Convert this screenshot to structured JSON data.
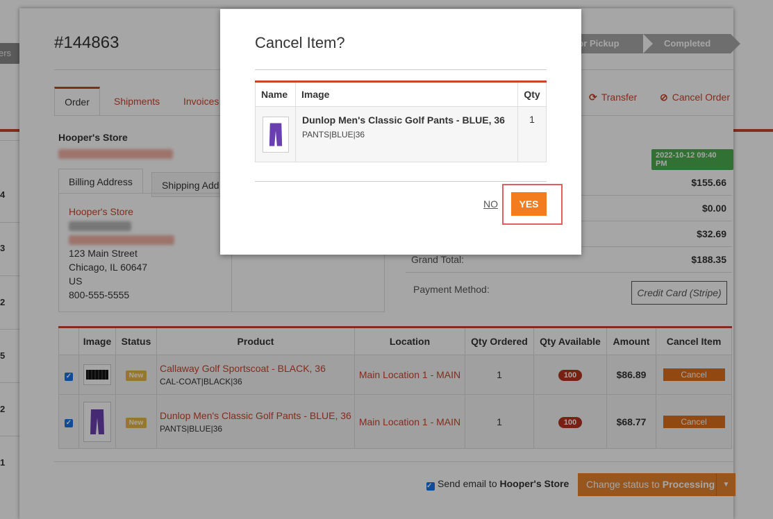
{
  "order": {
    "number": "#144863",
    "steps": [
      "for Pickup",
      "Completed"
    ],
    "tabs": [
      "Order",
      "Shipments",
      "Invoices"
    ],
    "actions": {
      "transfer": "Transfer",
      "cancel_order": "Cancel Order"
    },
    "store_name": "Hooper's Store",
    "address_tabs": [
      "Billing Address",
      "Shipping Add"
    ],
    "billing": {
      "name": "Hooper's Store",
      "street": "123 Main Street",
      "city": "Chicago, IL 60647",
      "country": "US",
      "phone": "800-555-5555"
    },
    "date_badge": "2022-10-12 09:40 PM",
    "totals": [
      {
        "label": "",
        "value": "$155.66"
      },
      {
        "label": "",
        "value": "$0.00"
      },
      {
        "label": "",
        "value": "$32.69"
      },
      {
        "label": "Grand Total:",
        "value": "$188.35"
      }
    ],
    "payment_method_label": "Payment Method:",
    "payment_method": "Credit Card (Stripe)"
  },
  "items_table": {
    "headers": [
      "",
      "Image",
      "Status",
      "Product",
      "Location",
      "Qty Ordered",
      "Qty Available",
      "Amount",
      "Cancel Item"
    ],
    "rows": [
      {
        "status": "New",
        "product": "Callaway Golf Sportscoat - BLACK, 36",
        "sku": "CAL-COAT|BLACK|36",
        "location": "Main Location 1 - MAIN",
        "qty_ordered": "1",
        "qty_available": "100",
        "amount": "$86.89",
        "cancel": "Cancel"
      },
      {
        "status": "New",
        "product": "Dunlop Men's Classic Golf Pants - BLUE, 36",
        "sku": "PANTS|BLUE|36",
        "location": "Main Location 1 - MAIN",
        "qty_ordered": "1",
        "qty_available": "100",
        "amount": "$68.77",
        "cancel": "Cancel"
      }
    ]
  },
  "footer": {
    "send_email_prefix": "Send email to ",
    "send_email_store": "Hooper's Store",
    "status_prefix": "Change status to ",
    "status_value": "Processing"
  },
  "background_left": {
    "pill": "ers to",
    "numbers": [
      "4",
      "3",
      "2",
      "5",
      "2",
      "1"
    ]
  },
  "modal": {
    "title": "Cancel Item?",
    "headers": [
      "Name",
      "Image",
      "Qty"
    ],
    "product_name": "Dunlop Men's Classic Golf Pants - BLUE, 36",
    "product_sku": "PANTS|BLUE|36",
    "qty": "1",
    "no_label": "NO",
    "yes_label": "YES"
  },
  "colors": {
    "accent": "#c9442b",
    "yes_button": "#f37c1f",
    "cancel_button": "#e0701b",
    "highlight": "#e25d5d"
  },
  "icons": {
    "transfer": "refresh-icon",
    "cancel_order": "ban-icon",
    "checkbox": "checkbox-checked-icon",
    "caret": "caret-down-icon"
  }
}
